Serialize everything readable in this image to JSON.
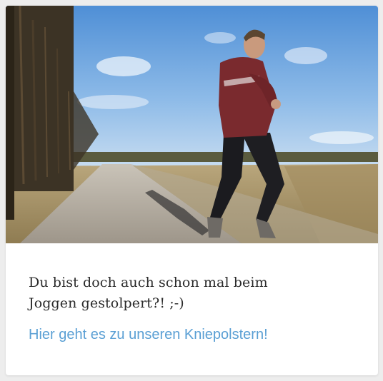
{
  "card": {
    "image": {
      "icon": "jogging-man-photo"
    },
    "headline": "Du bist doch auch schon mal beim\nJoggen gestolpert?! ;-)",
    "cta": "Hier geht es zu unseren Kniepolstern!"
  },
  "colors": {
    "headline": "#2a2a2a",
    "link": "#5a9fd4",
    "background": "#ededed"
  }
}
